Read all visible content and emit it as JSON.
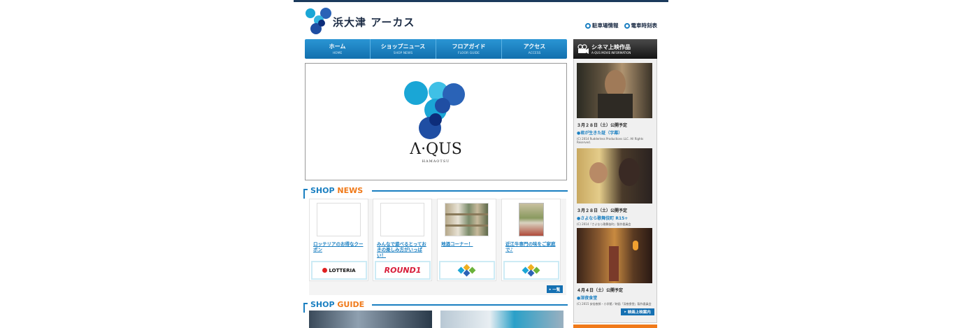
{
  "site": {
    "logo_text": "浜大津 アーカス"
  },
  "header_links": [
    {
      "label": "駐車場情報"
    },
    {
      "label": "電車時刻表"
    }
  ],
  "nav": [
    {
      "label": "ホーム",
      "sub": "HOME"
    },
    {
      "label": "ショップニュース",
      "sub": "SHOP NEWS"
    },
    {
      "label": "フロアガイド",
      "sub": "FLOOR GUIDE"
    },
    {
      "label": "アクセス",
      "sub": "ACCESS"
    }
  ],
  "hero": {
    "title": "Λ·QUS",
    "subtitle": "HAMAOTSU"
  },
  "shop_news": {
    "heading_a": "SHOP",
    "heading_b": "NEWS",
    "items": [
      {
        "title": "ロッテリアのお得なクーポン",
        "logo": "LOTTERIA"
      },
      {
        "title": "みんなで遊べるとっておきの楽しみ方がいっぱい！",
        "logo": "ROUND1"
      },
      {
        "title": "地酒コーナー！",
        "logo": ""
      },
      {
        "title": "近江牛専門の味をご家庭で♪",
        "logo": ""
      }
    ],
    "more_label": "一覧"
  },
  "shop_guide": {
    "heading_a": "SHOP",
    "heading_b": "GUIDE"
  },
  "cinema": {
    "title": "シネマ上映作品",
    "subtitle": "A-QUS MOVIE INFORMATION",
    "movies": [
      {
        "date": "３月２８日（土）公開予定",
        "title": "●君が生きた証（字幕）",
        "copy": "(C) 2014 Rudderless Productions LLC. All Rights Reserved."
      },
      {
        "date": "３月２８日（土）公開予定",
        "title": "●さよなら歌舞伎町 R15+",
        "copy": "(C) 2014『さよなら歌舞伎町』製作委員会"
      },
      {
        "date": "４月４日（土）公開予定",
        "title": "●深夜食堂",
        "copy": "(C) 2015 安倍夜郎・小学館／映画「深夜食堂」製作委員会"
      }
    ],
    "more_label": "映画上映案内"
  }
}
